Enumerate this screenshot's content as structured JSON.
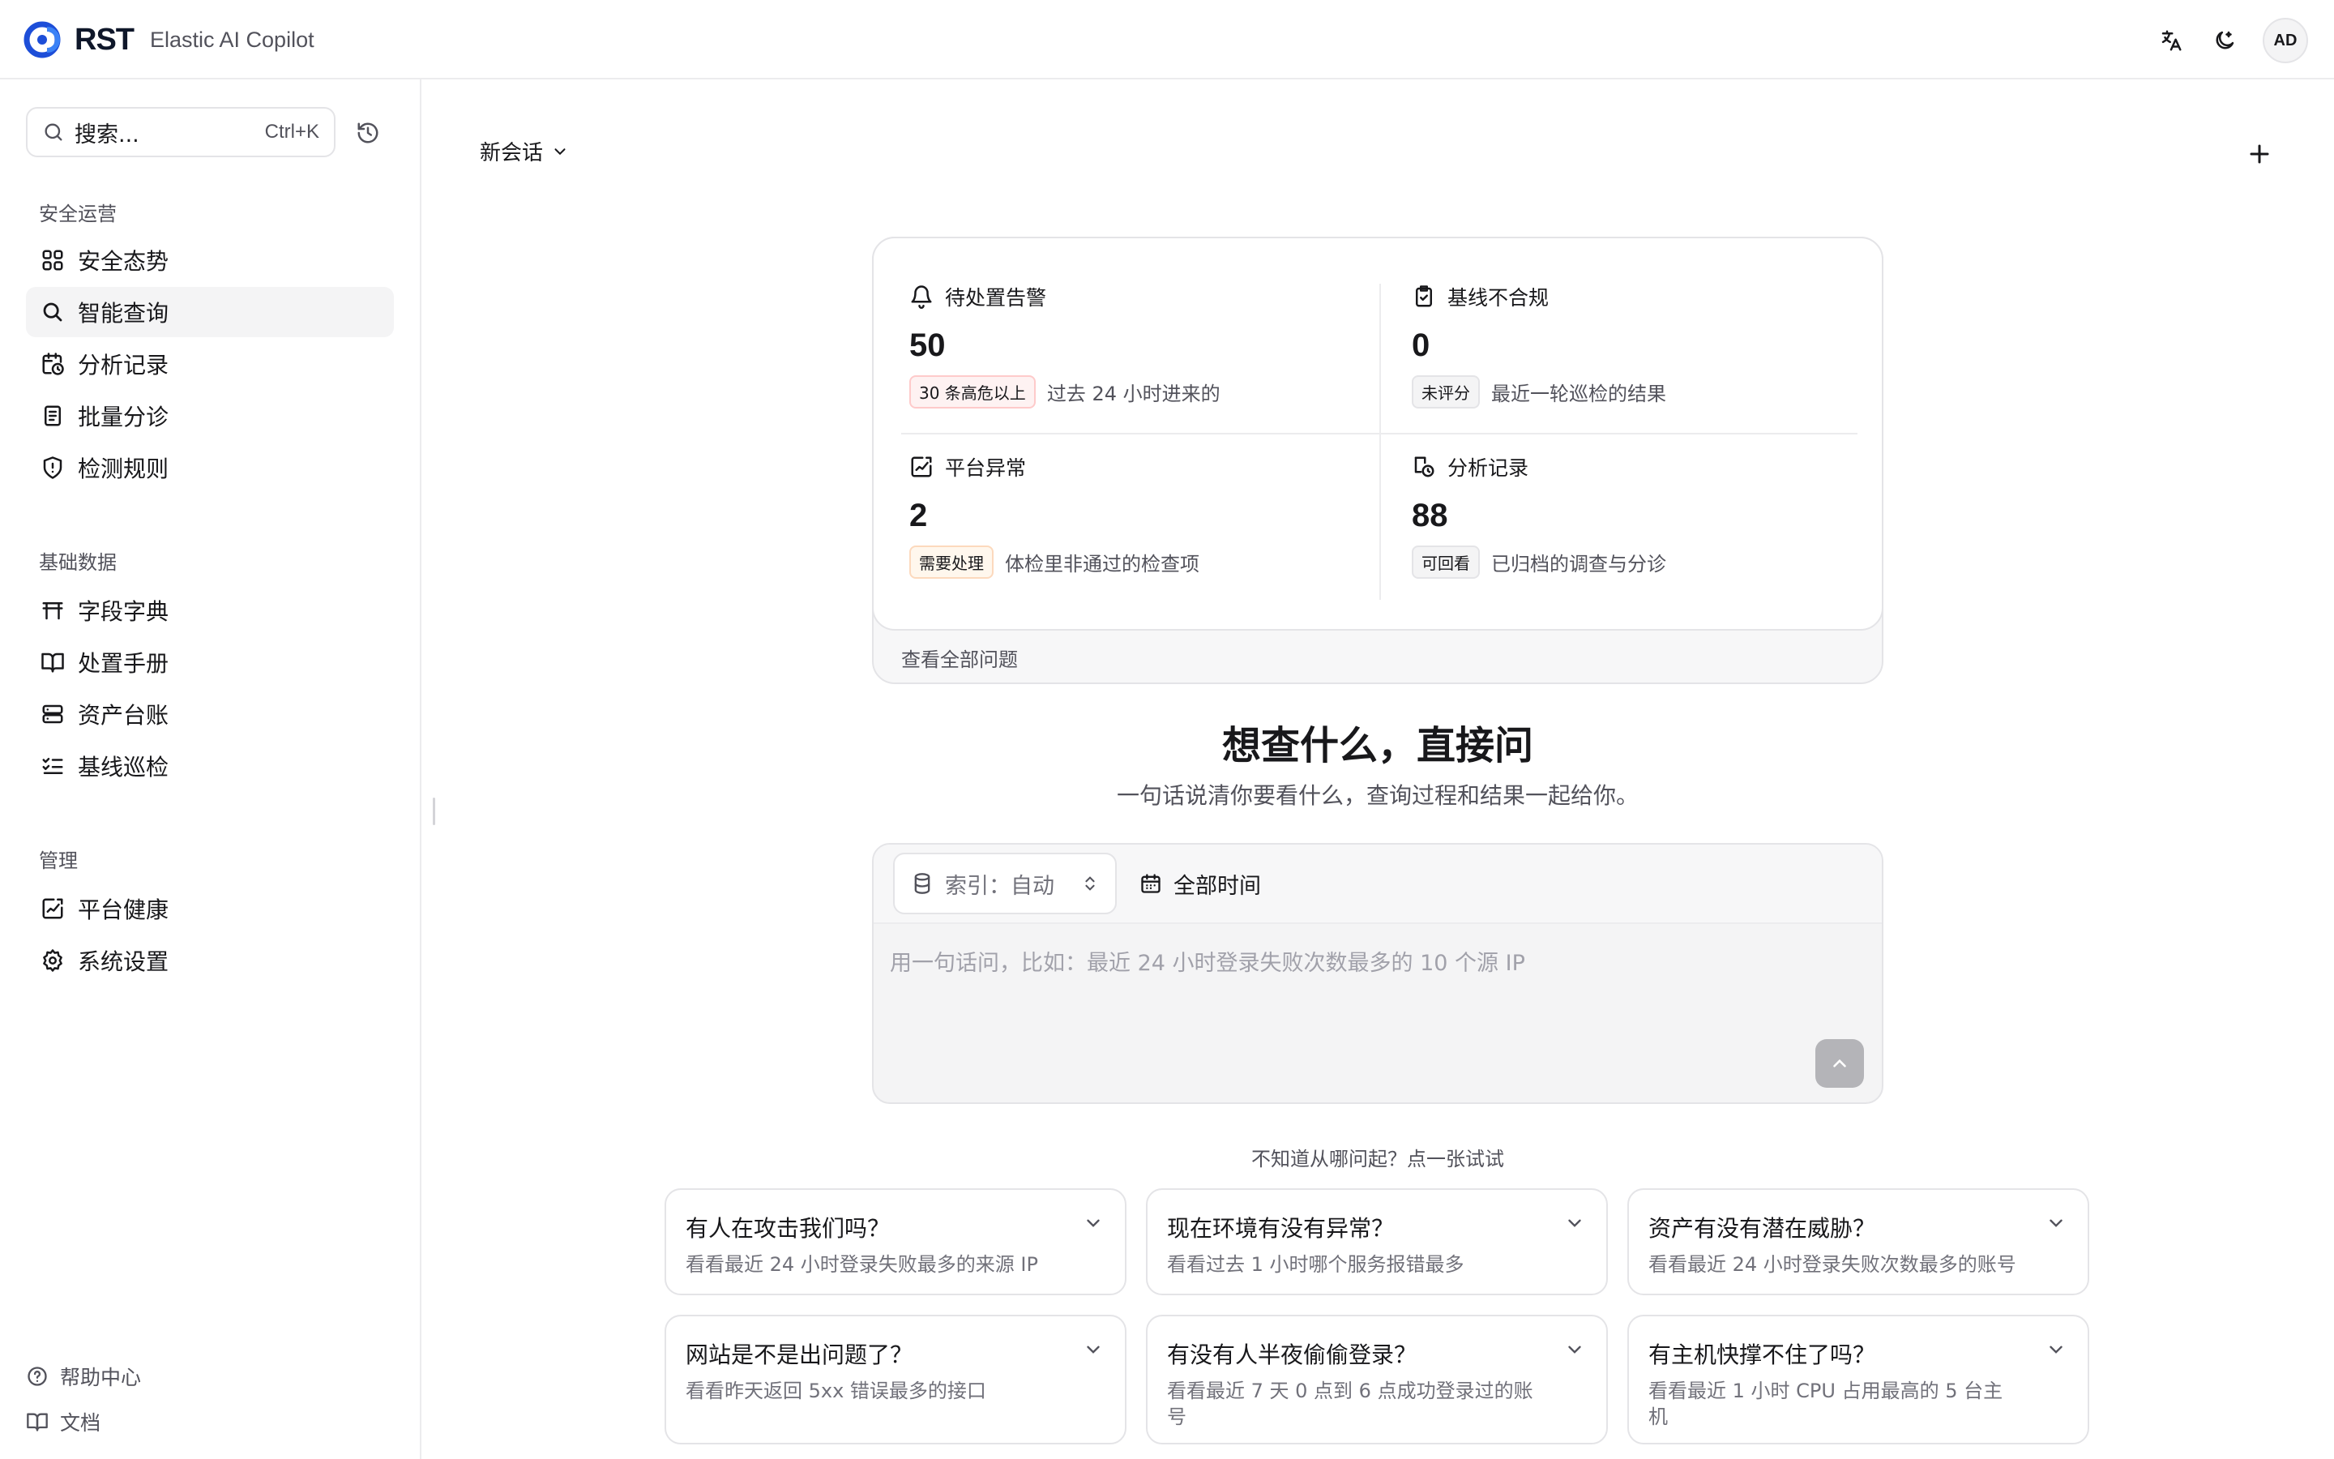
{
  "app": {
    "brand": "RST",
    "subtitle": "Elastic AI Copilot",
    "avatar_initials": "AD"
  },
  "sidebar": {
    "search_placeholder": "搜索...",
    "search_shortcut": "Ctrl+K",
    "sections": [
      {
        "label": "安全运营",
        "items": [
          {
            "label": "安全态势",
            "icon": "grid-icon"
          },
          {
            "label": "智能查询",
            "icon": "search-icon",
            "active": true
          },
          {
            "label": "分析记录",
            "icon": "calendar-clock-icon"
          },
          {
            "label": "批量分诊",
            "icon": "clipboard-list-icon"
          },
          {
            "label": "检测规则",
            "icon": "shield-alert-icon"
          }
        ]
      },
      {
        "label": "基础数据",
        "items": [
          {
            "label": "字段字典",
            "icon": "table-icon"
          },
          {
            "label": "处置手册",
            "icon": "book-open-icon"
          },
          {
            "label": "资产台账",
            "icon": "server-icon"
          },
          {
            "label": "基线巡检",
            "icon": "list-checks-icon"
          }
        ]
      },
      {
        "label": "管理",
        "items": [
          {
            "label": "平台健康",
            "icon": "activity-square-icon"
          },
          {
            "label": "系统设置",
            "icon": "gear-icon"
          }
        ]
      }
    ],
    "footer": [
      {
        "label": "帮助中心",
        "icon": "help-circle-icon"
      },
      {
        "label": "文档",
        "icon": "book-icon"
      }
    ]
  },
  "main": {
    "session_label": "新会话",
    "overview": {
      "stats": [
        {
          "title": "待处置告警",
          "value": "50",
          "badge": "30 条高危以上",
          "badge_tone": "red",
          "desc": "过去 24 小时进来的",
          "icon": "bell-icon"
        },
        {
          "title": "基线不合规",
          "value": "0",
          "badge": "未评分",
          "badge_tone": "gray",
          "desc": "最近一轮巡检的结果",
          "icon": "clipboard-check-icon"
        },
        {
          "title": "平台异常",
          "value": "2",
          "badge": "需要处理",
          "badge_tone": "amber",
          "desc": "体检里非通过的检查项",
          "icon": "activity-square-icon"
        },
        {
          "title": "分析记录",
          "value": "88",
          "badge": "可回看",
          "badge_tone": "gray",
          "desc": "已归档的调查与分诊",
          "icon": "history-list-icon"
        }
      ],
      "view_all": "查看全部问题"
    },
    "hero": {
      "title": "想查什么，直接问",
      "subtitle": "一句话说清你要看什么，查询过程和结果一起给你。"
    },
    "composer": {
      "index_label": "索引：自动",
      "time_label": "全部时间",
      "placeholder": "用一句话问，比如：最近 24 小时登录失败次数最多的 10 个源 IP"
    },
    "prompt_hint": "不知道从哪问起？点一张试试",
    "prompt_cards": [
      {
        "title": "有人在攻击我们吗？",
        "desc": "看看最近 24 小时登录失败最多的来源 IP"
      },
      {
        "title": "现在环境有没有异常？",
        "desc": "看看过去 1 小时哪个服务报错最多"
      },
      {
        "title": "资产有没有潜在威胁？",
        "desc": "看看最近 24 小时登录失败次数最多的账号"
      },
      {
        "title": "网站是不是出问题了？",
        "desc": "看看昨天返回 5xx 错误最多的接口"
      },
      {
        "title": "有没有人半夜偷偷登录？",
        "desc": "看看最近 7 天 0 点到 6 点成功登录过的账号"
      },
      {
        "title": "有主机快撑不住了吗？",
        "desc": "看看最近 1 小时 CPU 占用最高的 5 台主机"
      }
    ]
  }
}
